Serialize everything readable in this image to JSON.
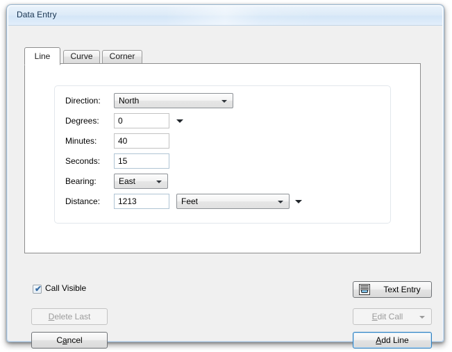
{
  "window": {
    "title": "Data Entry"
  },
  "tabs": [
    {
      "label": "Line",
      "active": true
    },
    {
      "label": "Curve",
      "active": false
    },
    {
      "label": "Corner",
      "active": false
    }
  ],
  "form": {
    "direction": {
      "label": "Direction:",
      "value": "North",
      "control": "combobox"
    },
    "degrees": {
      "label": "Degrees:",
      "value": "0",
      "control": "textbox-with-dropdown"
    },
    "minutes": {
      "label": "Minutes:",
      "value": "40",
      "control": "textbox"
    },
    "seconds": {
      "label": "Seconds:",
      "value": "15",
      "control": "textbox"
    },
    "bearing": {
      "label": "Bearing:",
      "value": "East",
      "control": "combobox"
    },
    "distance": {
      "label": "Distance:",
      "value": "1213",
      "control": "textbox",
      "units_value": "Feet",
      "units_control": "combobox"
    }
  },
  "options": {
    "call_visible": {
      "label": "Call Visible",
      "checked": true,
      "check_glyph": "✔"
    }
  },
  "buttons": {
    "delete_last": {
      "label": "Delete Last",
      "accel": "D",
      "enabled": false
    },
    "cancel": {
      "label": "Cancel",
      "accel": "a",
      "enabled": true
    },
    "text_entry": {
      "label": "Text Entry",
      "enabled": true,
      "icon": "text-entry-icon"
    },
    "edit_call": {
      "label": "Edit Call",
      "accel": "E",
      "enabled": false,
      "has_dropdown": true
    },
    "add_line": {
      "label": "Add Line",
      "accel": "A",
      "enabled": true,
      "is_default": true
    }
  },
  "colors": {
    "title_bar": "#dbe9f8",
    "window_border": "#9cb6cd",
    "client_bg": "#f0f0f0",
    "tab_page_bg": "#ffffff",
    "default_button_border": "#2f7fbf",
    "textbox_border": "#b0c4d4",
    "disabled_text": "#9b9b9b"
  }
}
